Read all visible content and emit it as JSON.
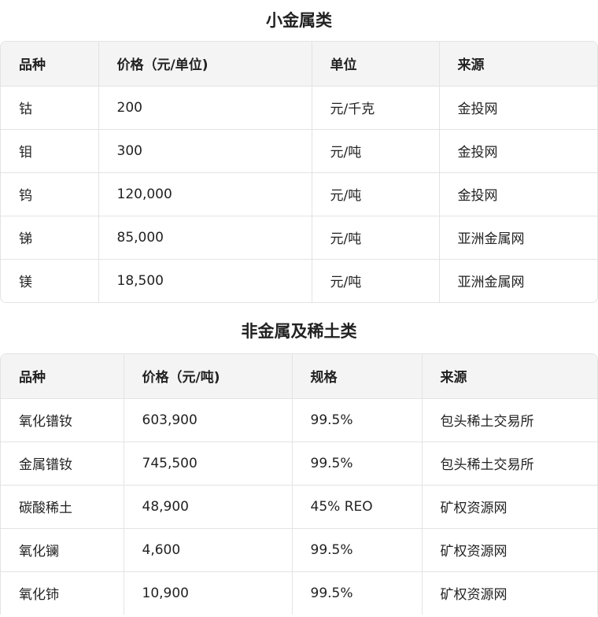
{
  "section1": {
    "title": "小金属类",
    "headers": [
      "品种",
      "价格（元/单位)",
      "单位",
      "来源"
    ],
    "rows": [
      [
        "钴",
        "200",
        "元/千克",
        "金投网"
      ],
      [
        "钼",
        "300",
        "元/吨",
        "金投网"
      ],
      [
        "钨",
        "120,000",
        "元/吨",
        "金投网"
      ],
      [
        "锑",
        "85,000",
        "元/吨",
        "亚洲金属网"
      ],
      [
        "镁",
        "18,500",
        "元/吨",
        "亚洲金属网"
      ]
    ]
  },
  "section2": {
    "title": "非金属及稀土类",
    "headers": [
      "品种",
      "价格（元/吨)",
      "规格",
      "来源"
    ],
    "rows": [
      [
        "氧化镨钕",
        "603,900",
        "99.5%",
        "包头稀土交易所"
      ],
      [
        "金属镨钕",
        "745,500",
        "99.5%",
        "包头稀土交易所"
      ],
      [
        "碳酸稀土",
        "48,900",
        "45% REO",
        "矿权资源网"
      ],
      [
        "氧化镧",
        "4,600",
        "99.5%",
        "矿权资源网"
      ],
      [
        "氧化铈",
        "10,900",
        "99.5%",
        "矿权资源网"
      ]
    ]
  }
}
